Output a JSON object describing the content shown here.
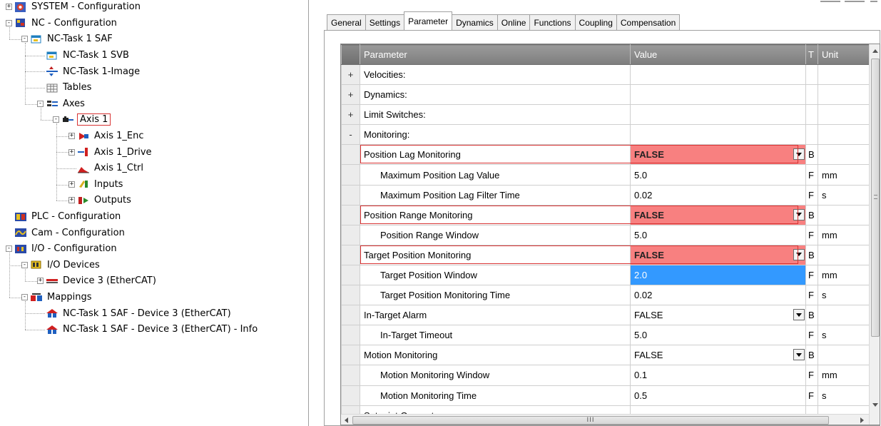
{
  "tree": {
    "nodes": [
      {
        "label": "SYSTEM - Configuration",
        "toggle": "+",
        "icon": "system-config-icon",
        "level": 0
      },
      {
        "label": "NC - Configuration",
        "toggle": "-",
        "icon": "nc-config-icon",
        "level": 0
      },
      {
        "label": "NC-Task 1 SAF",
        "toggle": "-",
        "icon": "task-icon",
        "level": 1
      },
      {
        "label": "NC-Task 1 SVB",
        "toggle": "",
        "icon": "task-icon",
        "level": 2
      },
      {
        "label": "NC-Task 1-Image",
        "toggle": "",
        "icon": "image-icon",
        "level": 2
      },
      {
        "label": "Tables",
        "toggle": "",
        "icon": "table-icon",
        "level": 2
      },
      {
        "label": "Axes",
        "toggle": "-",
        "icon": "axes-icon",
        "level": 2
      },
      {
        "label": "Axis 1",
        "toggle": "-",
        "icon": "axis-icon",
        "level": 3
      },
      {
        "label": "Axis 1_Enc",
        "toggle": "+",
        "icon": "encoder-icon",
        "level": 4
      },
      {
        "label": "Axis 1_Drive",
        "toggle": "+",
        "icon": "drive-icon",
        "level": 4
      },
      {
        "label": "Axis 1_Ctrl",
        "toggle": "",
        "icon": "controller-icon",
        "level": 4
      },
      {
        "label": "Inputs",
        "toggle": "+",
        "icon": "inputs-icon",
        "level": 4
      },
      {
        "label": "Outputs",
        "toggle": "+",
        "icon": "outputs-icon",
        "level": 4
      },
      {
        "label": "PLC - Configuration",
        "toggle": "",
        "icon": "plc-config-icon",
        "level": 0
      },
      {
        "label": "Cam - Configuration",
        "toggle": "",
        "icon": "cam-config-icon",
        "level": 0
      },
      {
        "label": "I/O - Configuration",
        "toggle": "-",
        "icon": "io-config-icon",
        "level": 0
      },
      {
        "label": "I/O Devices",
        "toggle": "-",
        "icon": "io-devices-icon",
        "level": 1
      },
      {
        "label": "Device 3 (EtherCAT)",
        "toggle": "+",
        "icon": "ethercat-icon",
        "level": 2
      },
      {
        "label": "Mappings",
        "toggle": "-",
        "icon": "mappings-icon",
        "level": 1
      },
      {
        "label": "NC-Task 1 SAF - Device 3 (EtherCAT)",
        "toggle": "",
        "icon": "mapping-icon",
        "level": 2
      },
      {
        "label": "NC-Task 1 SAF - Device 3 (EtherCAT) - Info",
        "toggle": "",
        "icon": "mapping-icon",
        "level": 2
      }
    ],
    "selected": "Axis 1"
  },
  "tabs": [
    "General",
    "Settings",
    "Parameter",
    "Dynamics",
    "Online",
    "Functions",
    "Coupling",
    "Compensation"
  ],
  "active_tab": "Parameter",
  "grid": {
    "headers": {
      "parameter": "Parameter",
      "value": "Value",
      "type": "T",
      "unit": "Unit"
    },
    "rows": [
      {
        "gut": "+",
        "name": "Velocities:",
        "value": "",
        "t": "",
        "unit": "",
        "indent": false,
        "style": "group",
        "dropdown": false
      },
      {
        "gut": "+",
        "name": "Dynamics:",
        "value": "",
        "t": "",
        "unit": "",
        "indent": false,
        "style": "group",
        "dropdown": false
      },
      {
        "gut": "+",
        "name": "Limit Switches:",
        "value": "",
        "t": "",
        "unit": "",
        "indent": false,
        "style": "group",
        "dropdown": false
      },
      {
        "gut": "-",
        "name": "Monitoring:",
        "value": "",
        "t": "",
        "unit": "",
        "indent": false,
        "style": "group",
        "dropdown": false
      },
      {
        "gut": "",
        "name": "Position Lag Monitoring",
        "value": "FALSE",
        "t": "B",
        "unit": "",
        "indent": false,
        "style": "red",
        "dropdown": true,
        "highlight": true
      },
      {
        "gut": "",
        "name": "Maximum Position Lag Value",
        "value": "5.0",
        "t": "F",
        "unit": "mm",
        "indent": true,
        "style": "",
        "dropdown": false
      },
      {
        "gut": "",
        "name": "Maximum Position Lag Filter Time",
        "value": "0.02",
        "t": "F",
        "unit": "s",
        "indent": true,
        "style": "",
        "dropdown": false
      },
      {
        "gut": "",
        "name": "Position Range Monitoring",
        "value": "FALSE",
        "t": "B",
        "unit": "",
        "indent": false,
        "style": "red",
        "dropdown": true,
        "highlight": true
      },
      {
        "gut": "",
        "name": "Position Range Window",
        "value": "5.0",
        "t": "F",
        "unit": "mm",
        "indent": true,
        "style": "",
        "dropdown": false
      },
      {
        "gut": "",
        "name": "Target Position Monitoring",
        "value": "FALSE",
        "t": "B",
        "unit": "",
        "indent": false,
        "style": "red",
        "dropdown": true,
        "highlight": true
      },
      {
        "gut": "",
        "name": "Target Position Window",
        "value": "2.0",
        "t": "F",
        "unit": "mm",
        "indent": true,
        "style": "blue",
        "dropdown": false
      },
      {
        "gut": "",
        "name": "Target Position Monitoring Time",
        "value": "0.02",
        "t": "F",
        "unit": "s",
        "indent": true,
        "style": "",
        "dropdown": false
      },
      {
        "gut": "",
        "name": "In-Target Alarm",
        "value": "FALSE",
        "t": "B",
        "unit": "",
        "indent": false,
        "style": "",
        "dropdown": true
      },
      {
        "gut": "",
        "name": "In-Target Timeout",
        "value": "5.0",
        "t": "F",
        "unit": "s",
        "indent": true,
        "style": "",
        "dropdown": false
      },
      {
        "gut": "",
        "name": "Motion Monitoring",
        "value": "FALSE",
        "t": "B",
        "unit": "",
        "indent": false,
        "style": "",
        "dropdown": true
      },
      {
        "gut": "",
        "name": "Motion Monitoring Window",
        "value": "0.1",
        "t": "F",
        "unit": "mm",
        "indent": true,
        "style": "",
        "dropdown": false
      },
      {
        "gut": "",
        "name": "Motion Monitoring Time",
        "value": "0.5",
        "t": "F",
        "unit": "s",
        "indent": true,
        "style": "",
        "dropdown": false
      },
      {
        "gut": "",
        "name": "Setpoint Generator:",
        "value": "",
        "t": "",
        "unit": "",
        "indent": false,
        "style": "",
        "dropdown": false
      }
    ]
  },
  "colors": {
    "highlight_red": "#f88080",
    "selection_blue": "#3399ff",
    "annotation_red": "#d83333"
  }
}
